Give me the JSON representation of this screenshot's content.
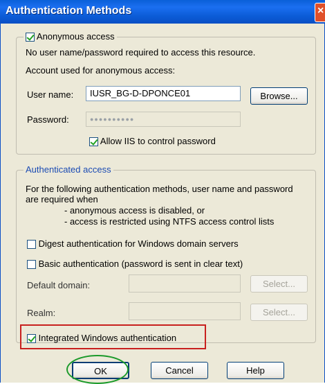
{
  "window": {
    "title": "Authentication Methods",
    "close_glyph": "×"
  },
  "anonymous": {
    "checkbox_label": "Anonymous access",
    "checked": true,
    "description": "No user name/password required to access this resource.",
    "account_label": "Account used for anonymous access:",
    "username_label": "User name:",
    "username_value": "IUSR_BG-D-DPONCE01",
    "browse_label": "Browse...",
    "password_label": "Password:",
    "password_value": "●●●●●●●●●●",
    "allow_iis_label": "Allow IIS to control password",
    "allow_iis_checked": true
  },
  "authenticated": {
    "legend": "Authenticated access",
    "description_line1": "For the following authentication methods, user name and password",
    "description_line2": "are required when",
    "bullet1": "- anonymous access is disabled, or",
    "bullet2": "- access is restricted using NTFS access control lists",
    "digest_label": "Digest authentication for Windows domain servers",
    "basic_label": "Basic authentication (password is sent in clear text)",
    "default_domain_label": "Default domain:",
    "realm_label": "Realm:",
    "select_label": "Select...",
    "integrated_label": "Integrated Windows authentication"
  },
  "buttons": {
    "ok": "OK",
    "cancel": "Cancel",
    "help": "Help"
  },
  "colors": {
    "title_blue": "#0a5fd8",
    "dialog_bg": "#ece9d8",
    "highlight_red": "#c8201e",
    "highlight_green": "#1b9a2a"
  }
}
